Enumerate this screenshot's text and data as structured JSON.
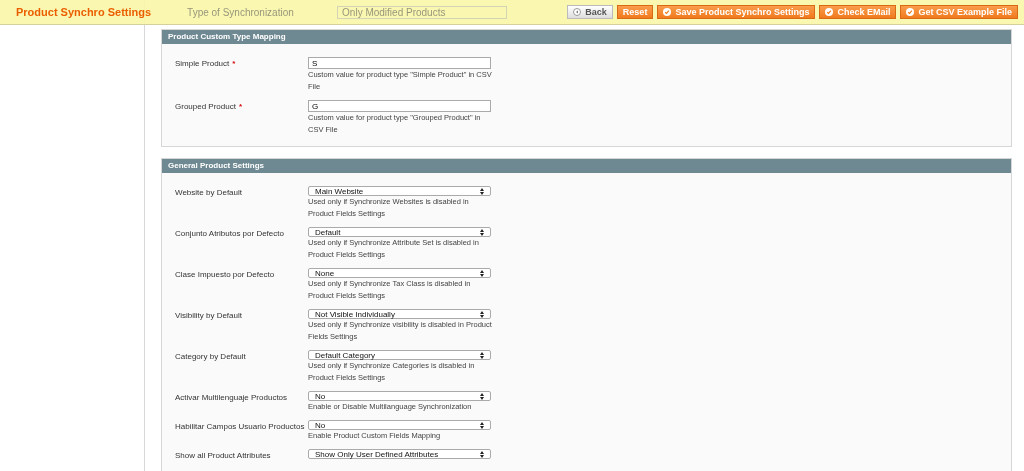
{
  "header": {
    "title": "Product Synchro Settings",
    "behind_label": "Type of Synchronization",
    "behind_value": "Only Modified Products",
    "buttons": [
      {
        "label": "Back",
        "kind": "back"
      },
      {
        "label": "Reset",
        "kind": "plain"
      },
      {
        "label": "Save Product Synchro Settings",
        "kind": "action"
      },
      {
        "label": "Check EMail",
        "kind": "action"
      },
      {
        "label": "Get CSV Example File",
        "kind": "action"
      }
    ]
  },
  "sections": [
    {
      "title": "Product Custom Type Mapping",
      "fields": [
        {
          "label": "Simple Product",
          "required_mark": "*",
          "kind": "text",
          "value": "S",
          "note": "Custom value for product type \"Simple Product\" in CSV File"
        },
        {
          "label": "Grouped Product",
          "required_mark": "*",
          "kind": "text",
          "value": "G",
          "note": "Custom value for product type \"Grouped Product\" in CSV File"
        }
      ]
    },
    {
      "title": "General Product Settings",
      "fields": [
        {
          "label": "Website by Default",
          "kind": "select",
          "value": "Main Website",
          "note": "Used only if Synchronize Websites is disabled in Product Fields Settings"
        },
        {
          "label": "Conjunto Atributos por Defecto",
          "kind": "select",
          "value": "Default",
          "note": "Used only if Synchronize Attribute Set is disabled in Product Fields Settings"
        },
        {
          "label": "Clase Impuesto por Defecto",
          "kind": "select",
          "value": "None",
          "note": "Used only if Synchronize Tax Class is disabled in Product Fields Settings"
        },
        {
          "label": "Visibility by Default",
          "kind": "select",
          "value": "Not Visible Individually",
          "note": "Used only if Synchronize visibility is disabled in Product Fields Settings"
        },
        {
          "label": "Category by Default",
          "kind": "select",
          "value": "Default Category",
          "note": "Used only if Synchronize Categories is disabled in Product Fields Settings"
        },
        {
          "label": "Activar Multilenguaje Productos",
          "kind": "select",
          "value": "No",
          "note": "Enable or Disable Multilanguage Synchronization"
        },
        {
          "label": "Habilitar Campos Usuario Productos",
          "kind": "select",
          "value": "No",
          "note": "Enable Product Custom Fields Mapping"
        },
        {
          "label": "Show all Product Attributes",
          "kind": "select",
          "value": "Show Only User Defined Attributes"
        }
      ]
    }
  ]
}
